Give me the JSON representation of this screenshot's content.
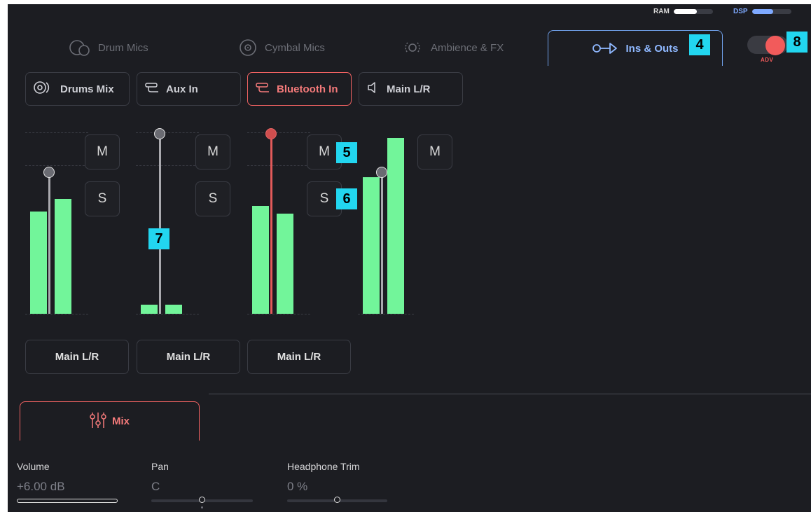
{
  "meters": {
    "ram_label": "RAM",
    "ram_level": 0.6,
    "dsp_label": "DSP",
    "dsp_level": 0.55,
    "ram_color": "#ffffff",
    "dsp_color": "#7ea9ff"
  },
  "top_tabs": [
    {
      "label": "Drum Mics",
      "icon": "drum-icon",
      "active": false
    },
    {
      "label": "Cymbal Mics",
      "icon": "cymbal-icon",
      "active": false
    },
    {
      "label": "Ambience & FX",
      "icon": "ambience-icon",
      "active": false
    },
    {
      "label": "Ins & Outs",
      "icon": "ins-outs-icon",
      "active": true
    }
  ],
  "adv_toggle": {
    "label": "ADV",
    "on": true
  },
  "channel_tabs": [
    {
      "label": "Drums Mix",
      "icon": "drums-mix-icon",
      "active": false
    },
    {
      "label": "Aux In",
      "icon": "aux-cable-icon",
      "active": false
    },
    {
      "label": "Bluetooth In",
      "icon": "aux-cable-icon",
      "active": true
    },
    {
      "label": "Main L/R",
      "icon": "speaker-icon",
      "active": false
    }
  ],
  "channels": [
    {
      "mute_label": "M",
      "solo_label": "S",
      "route": "Main L/R",
      "fader_level": 0.79,
      "meter_left": 0.57,
      "meter_right": 0.64,
      "accent": "gray"
    },
    {
      "mute_label": "M",
      "solo_label": "S",
      "route": "Main L/R",
      "fader_level": 1.0,
      "meter_left": 0.05,
      "meter_right": 0.05,
      "accent": "gray"
    },
    {
      "mute_label": "M",
      "solo_label": "S",
      "route": "Main L/R",
      "fader_level": 1.0,
      "meter_left": 0.6,
      "meter_right": 0.56,
      "accent": "red"
    },
    {
      "mute_label": "M",
      "solo_label": "",
      "route": "",
      "fader_level": 0.79,
      "meter_left": 0.76,
      "meter_right": 0.98,
      "accent": "gray"
    }
  ],
  "markers": [
    "4",
    "5",
    "6",
    "7",
    "8"
  ],
  "bottom": {
    "mix_tab_label": "Mix",
    "volume_label": "Volume",
    "volume_value": "+6.00 dB",
    "pan_label": "Pan",
    "pan_value": "C",
    "pan_position": 0.5,
    "headphone_label": "Headphone Trim",
    "headphone_value": "0 %",
    "headphone_position": 0.5
  },
  "colors": {
    "background": "#1c1d22",
    "accent_red": "#f06262",
    "accent_blue": "#6f9fe8",
    "meter_green": "#72f59a",
    "marker_cyan": "#22d6f0"
  }
}
